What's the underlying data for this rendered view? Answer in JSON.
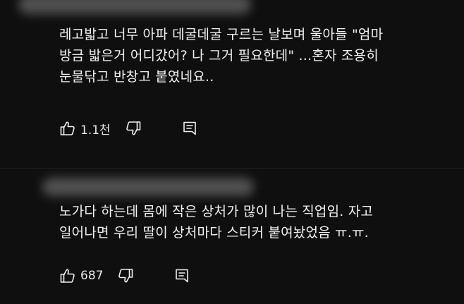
{
  "comments": [
    {
      "text": "레고밟고 너무 아파 데굴데굴 구르는 날보며 울아들 \"엄마\n방금 밟은거 어디갔어? 나 그거 필요한데\" ...혼자 조용히\n눈물닦고 반창고 붙였네요..",
      "likes": "1.1천"
    },
    {
      "text": "노가다 하는데 몸에 작은 상처가 많이 나는 직업임. 자고\n일어나면 우리 딸이 상처마다 스티커 붙여놨었음 ㅠ.ㅠ.",
      "likes": "687"
    }
  ],
  "icons": {
    "like": "thumbs-up-icon",
    "dislike": "thumbs-down-icon",
    "reply": "reply-icon"
  },
  "colors": {
    "background": "#0f0f0f",
    "text": "#f1f1f1"
  }
}
